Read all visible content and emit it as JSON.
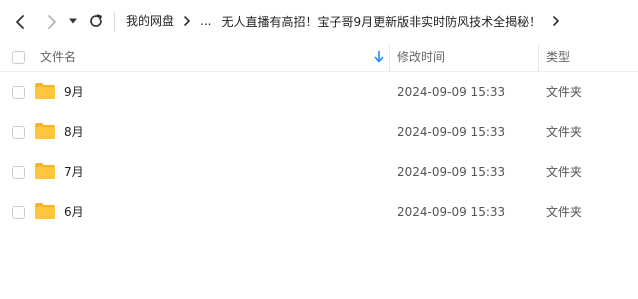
{
  "toolbar": {
    "back_icon": "chevron-left-icon",
    "forward_icon": "chevron-right-icon",
    "history_icon": "caret-down-icon",
    "refresh_icon": "refresh-icon"
  },
  "breadcrumb": {
    "root": "我的网盘",
    "ellipsis": "...",
    "current": "无人直播有高招！宝子哥9月更新版非实时防风技术全揭秘！",
    "separator_icon": "chevron-right-icon"
  },
  "table": {
    "columns": {
      "name": "文件名",
      "modified": "修改时间",
      "type": "类型"
    },
    "sort_icon": "sort-down-arrow-icon",
    "accent_color": "#1a8cff",
    "folder_color": "#ffc53d",
    "rows": [
      {
        "name": "9月",
        "modified": "2024-09-09 15:33",
        "type": "文件夹"
      },
      {
        "name": "8月",
        "modified": "2024-09-09 15:33",
        "type": "文件夹"
      },
      {
        "name": "7月",
        "modified": "2024-09-09 15:33",
        "type": "文件夹"
      },
      {
        "name": "6月",
        "modified": "2024-09-09 15:33",
        "type": "文件夹"
      }
    ]
  }
}
